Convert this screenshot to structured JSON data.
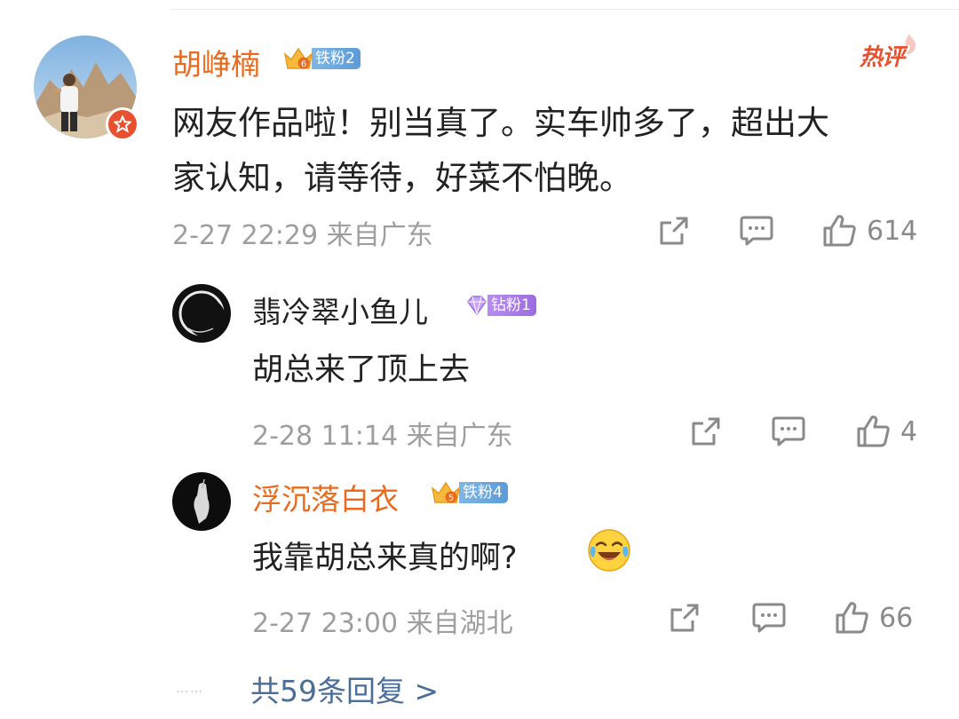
{
  "main_comment": {
    "author": "胡峥楠",
    "fan_badge": {
      "label": "铁粉2",
      "level": "6",
      "color": "#5b9ad8"
    },
    "hot_label": "热评",
    "text_line1": "网友作品啦！别当真了。实车帅多了，超出大",
    "text_line2": "家认知，请等待，好菜不怕晚。",
    "timestamp": "2-27 22:29 来自广东",
    "like_count": "614"
  },
  "replies": [
    {
      "author": "翡冷翠小鱼儿",
      "author_color": "#333333",
      "fan_badge": {
        "label": "钻粉1",
        "color": "#9b6de0"
      },
      "text": "胡总来了顶上去",
      "timestamp": "2-28 11:14 来自广东",
      "like_count": "4"
    },
    {
      "author": "浮沉落白衣",
      "author_color": "#e86b1f",
      "fan_badge": {
        "label": "铁粉4",
        "level": "5",
        "color": "#5b9ad8"
      },
      "text": "我靠胡总来真的啊?",
      "emoji": "laughing-crying-emoji",
      "timestamp": "2-27 23:00 来自湖北",
      "like_count": "66"
    }
  ],
  "more_replies": {
    "dots": "……",
    "label": "共59条回复 >"
  },
  "icons": {
    "share": "share-icon",
    "comment": "comment-icon",
    "like": "like-icon"
  }
}
